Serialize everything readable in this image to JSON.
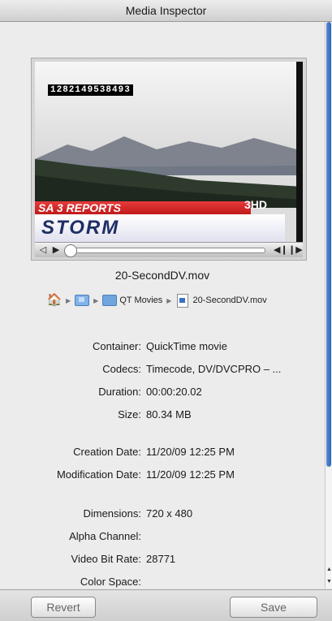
{
  "window": {
    "title": "Media Inspector"
  },
  "preview": {
    "timecode": "1282149538493",
    "banner_text": "SA 3 REPORTS",
    "banner_lower": "STORM",
    "station_logo": "3HD"
  },
  "file": {
    "name": "20-SecondDV.mov"
  },
  "path": {
    "folder_label": "QT Movies",
    "file_label": "20-SecondDV.mov"
  },
  "properties": [
    {
      "label": "Container:",
      "value": "QuickTime movie"
    },
    {
      "label": "Codecs:",
      "value": "Timecode, DV/DVCPRO – ..."
    },
    {
      "label": "Duration:",
      "value": "00:00:20.02"
    },
    {
      "label": "Size:",
      "value": "80.34 MB"
    },
    {
      "label": "Creation Date:",
      "value": "11/20/09 12:25 PM"
    },
    {
      "label": "Modification Date:",
      "value": "11/20/09 12:25 PM"
    },
    {
      "label": "Dimensions:",
      "value": "720 x 480"
    },
    {
      "label": "Alpha Channel:",
      "value": ""
    },
    {
      "label": "Video Bit Rate:",
      "value": "28771"
    },
    {
      "label": "Color Space:",
      "value": ""
    }
  ],
  "buttons": {
    "revert": "Revert",
    "save": "Save"
  },
  "controls": {
    "playback_position": 0.0
  }
}
